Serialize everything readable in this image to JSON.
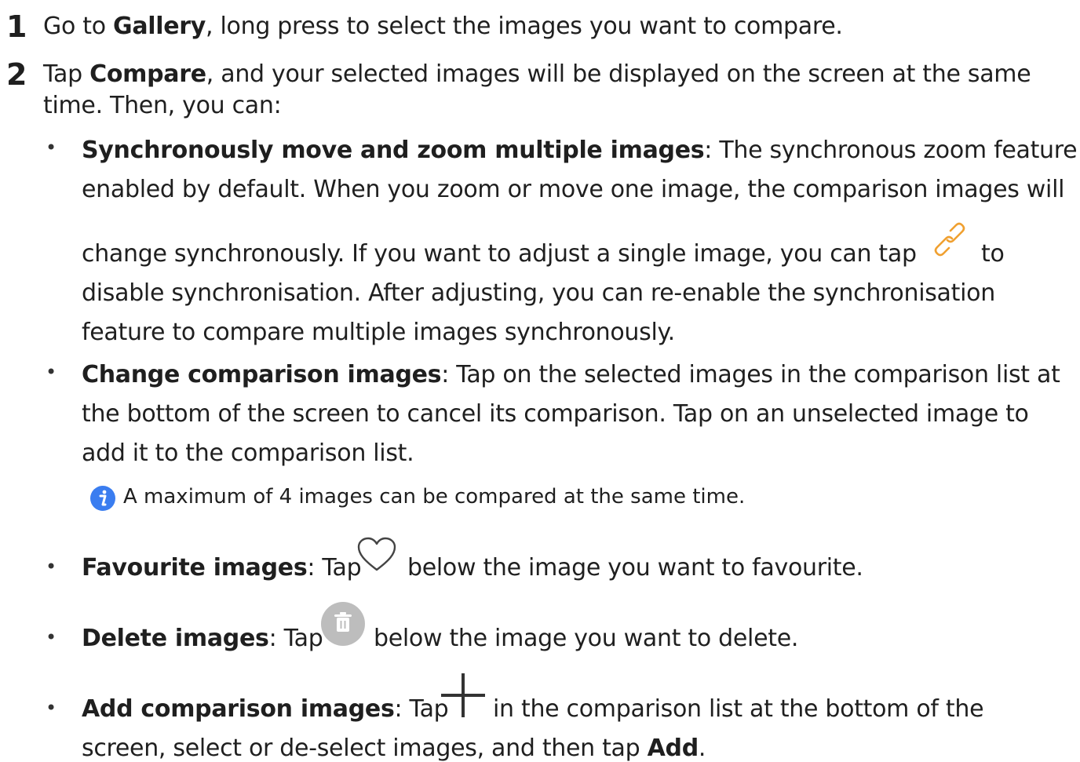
{
  "step1": {
    "number": "1",
    "pre": "Go to ",
    "bold": "Gallery",
    "post": ", long press to select the images you want to compare."
  },
  "step2": {
    "number": "2",
    "pre": "Tap ",
    "bold": "Compare",
    "post": ", and your selected images will be displayed on the screen at the same",
    "line2": "time. Then, you can:"
  },
  "bullets": {
    "sync": {
      "title": "Synchronously move and zoom multiple images",
      "l1": ": The synchronous zoom feature is",
      "l2": "enabled by default. When you zoom or move one image, the comparison images will",
      "l3a": "change synchronously. If you want to adjust a single image, you can tap",
      "l3b": "to",
      "l4": "disable synchronisation. After adjusting, you can re-enable the synchronisation",
      "l5": "feature to compare multiple images synchronously."
    },
    "change": {
      "title": "Change comparison images",
      "l1": ": Tap on the selected images in the comparison list at",
      "l2": "the bottom of the screen to cancel its comparison. Tap on an unselected image to",
      "l3": "add it to the comparison list."
    },
    "note": "A maximum of 4 images can be compared at the same time.",
    "favourite": {
      "title": "Favourite images",
      "pre": ": Tap",
      "post": "below the image you want to favourite."
    },
    "delete": {
      "title": "Delete images",
      "pre": ": Tap",
      "post": "below the image you want to delete."
    },
    "add": {
      "title": "Add comparison images",
      "pre": ": Tap",
      "post": "in the comparison list at the bottom of the",
      "l2pre": "screen, select or de-select images, and then tap ",
      "l2bold": "Add",
      "l2post": "."
    }
  },
  "icons": {
    "link": "link-icon",
    "info": "info-icon",
    "heart": "heart-icon",
    "trash": "trash-icon",
    "plus": "plus-icon"
  },
  "colors": {
    "link_icon": "#f0a030",
    "info_icon": "#3a7df0",
    "trash_bg": "#bdbdbd"
  }
}
